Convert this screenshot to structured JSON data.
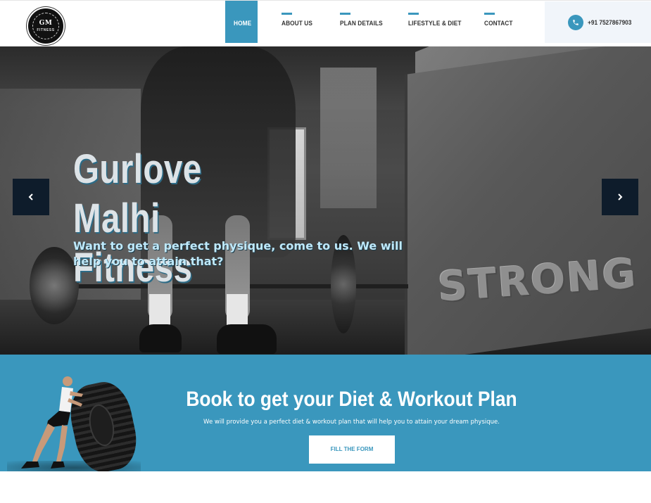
{
  "brand": {
    "logo_text": "GM",
    "logo_subtext": "FITNESS"
  },
  "nav": {
    "items": [
      {
        "label": "HOME",
        "active": true
      },
      {
        "label": "ABOUT US",
        "active": false
      },
      {
        "label": "PLAN DETAILS",
        "active": false
      },
      {
        "label": "LIFESTYLE & DIET",
        "active": false
      },
      {
        "label": "CONTACT",
        "active": false
      }
    ]
  },
  "contact": {
    "phone": "+91 7527867903",
    "icon": "phone-icon"
  },
  "hero": {
    "title": "Gurlove Malhi Fitness",
    "subtitle": "Want to get a perfect physique, come to us. We will help you to attain that?",
    "background_word": "STRONG",
    "prev_icon": "chevron-left-icon",
    "next_icon": "chevron-right-icon"
  },
  "booking": {
    "title": "Book to get your Diet & Workout Plan",
    "subtitle": "We will provide you a perfect diet & workout plan that will help you to attain your dream physique.",
    "button_label": "FILL THE FORM"
  },
  "colors": {
    "accent": "#3a97bd",
    "arrow_bg": "#0e1c2b",
    "hero_subtitle": "#bfe9fb",
    "phone_bg": "#f1f5fa"
  }
}
